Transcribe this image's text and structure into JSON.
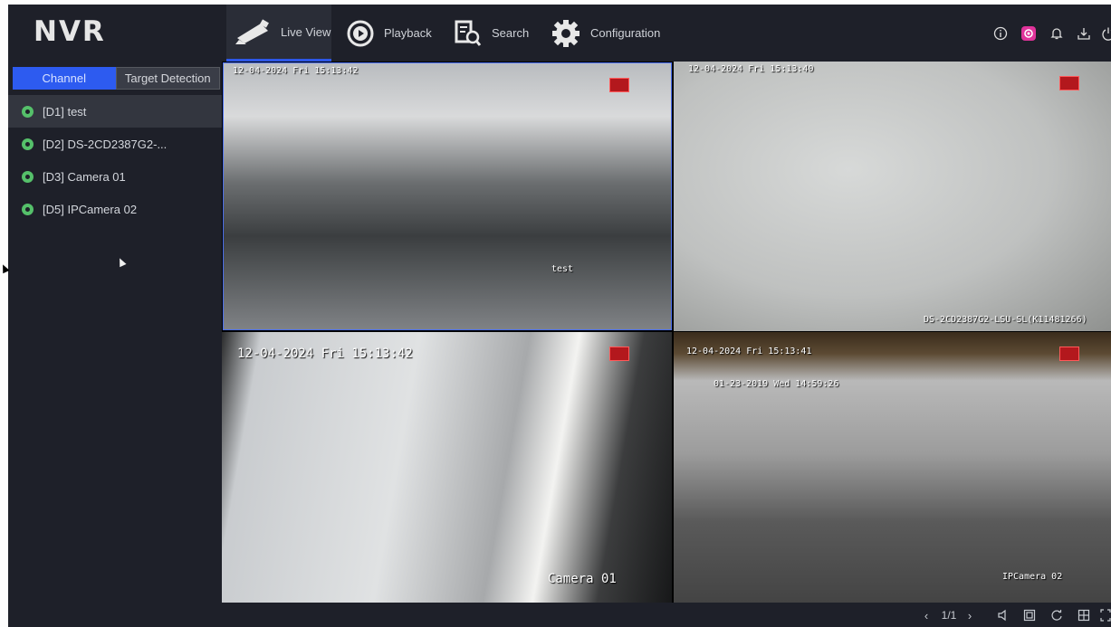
{
  "app": {
    "logo": "NVR"
  },
  "nav": {
    "live_view": "Live View",
    "playback": "Playback",
    "search": "Search",
    "configuration": "Configuration"
  },
  "tray_icons": [
    "info-icon",
    "camera-app-icon",
    "bell-icon",
    "download-icon",
    "power-icon"
  ],
  "sidebar": {
    "tabs": [
      "Channel",
      "Target Detection"
    ],
    "channels": [
      {
        "label": "[D1] test",
        "selected": true
      },
      {
        "label": "[D2] DS-2CD2387G2-...",
        "selected": false
      },
      {
        "label": "[D3] Camera 01",
        "selected": false
      },
      {
        "label": "[D5] IPCamera 02",
        "selected": false
      }
    ]
  },
  "views": [
    {
      "timestamp": "12-04-2024 Fri 15:13:42",
      "caption": "test"
    },
    {
      "timestamp": "12-04-2024 Fri 15:13:40",
      "caption": "DS-2CD2387G2-LSU-SL(K11481266)"
    },
    {
      "timestamp": "12-04-2024 Fri 15:13:42",
      "caption": "Camera 01"
    },
    {
      "timestamp": "12-04-2024 Fri 15:13:41",
      "caption": "IPCamera 02",
      "inner_timestamp": "01-23-2019 Wed 14:59:26"
    }
  ],
  "bottombar": {
    "page": "1/1"
  },
  "colors": {
    "accent": "#2d5bf0",
    "online": "#55c06a",
    "record": "#b3181d"
  }
}
